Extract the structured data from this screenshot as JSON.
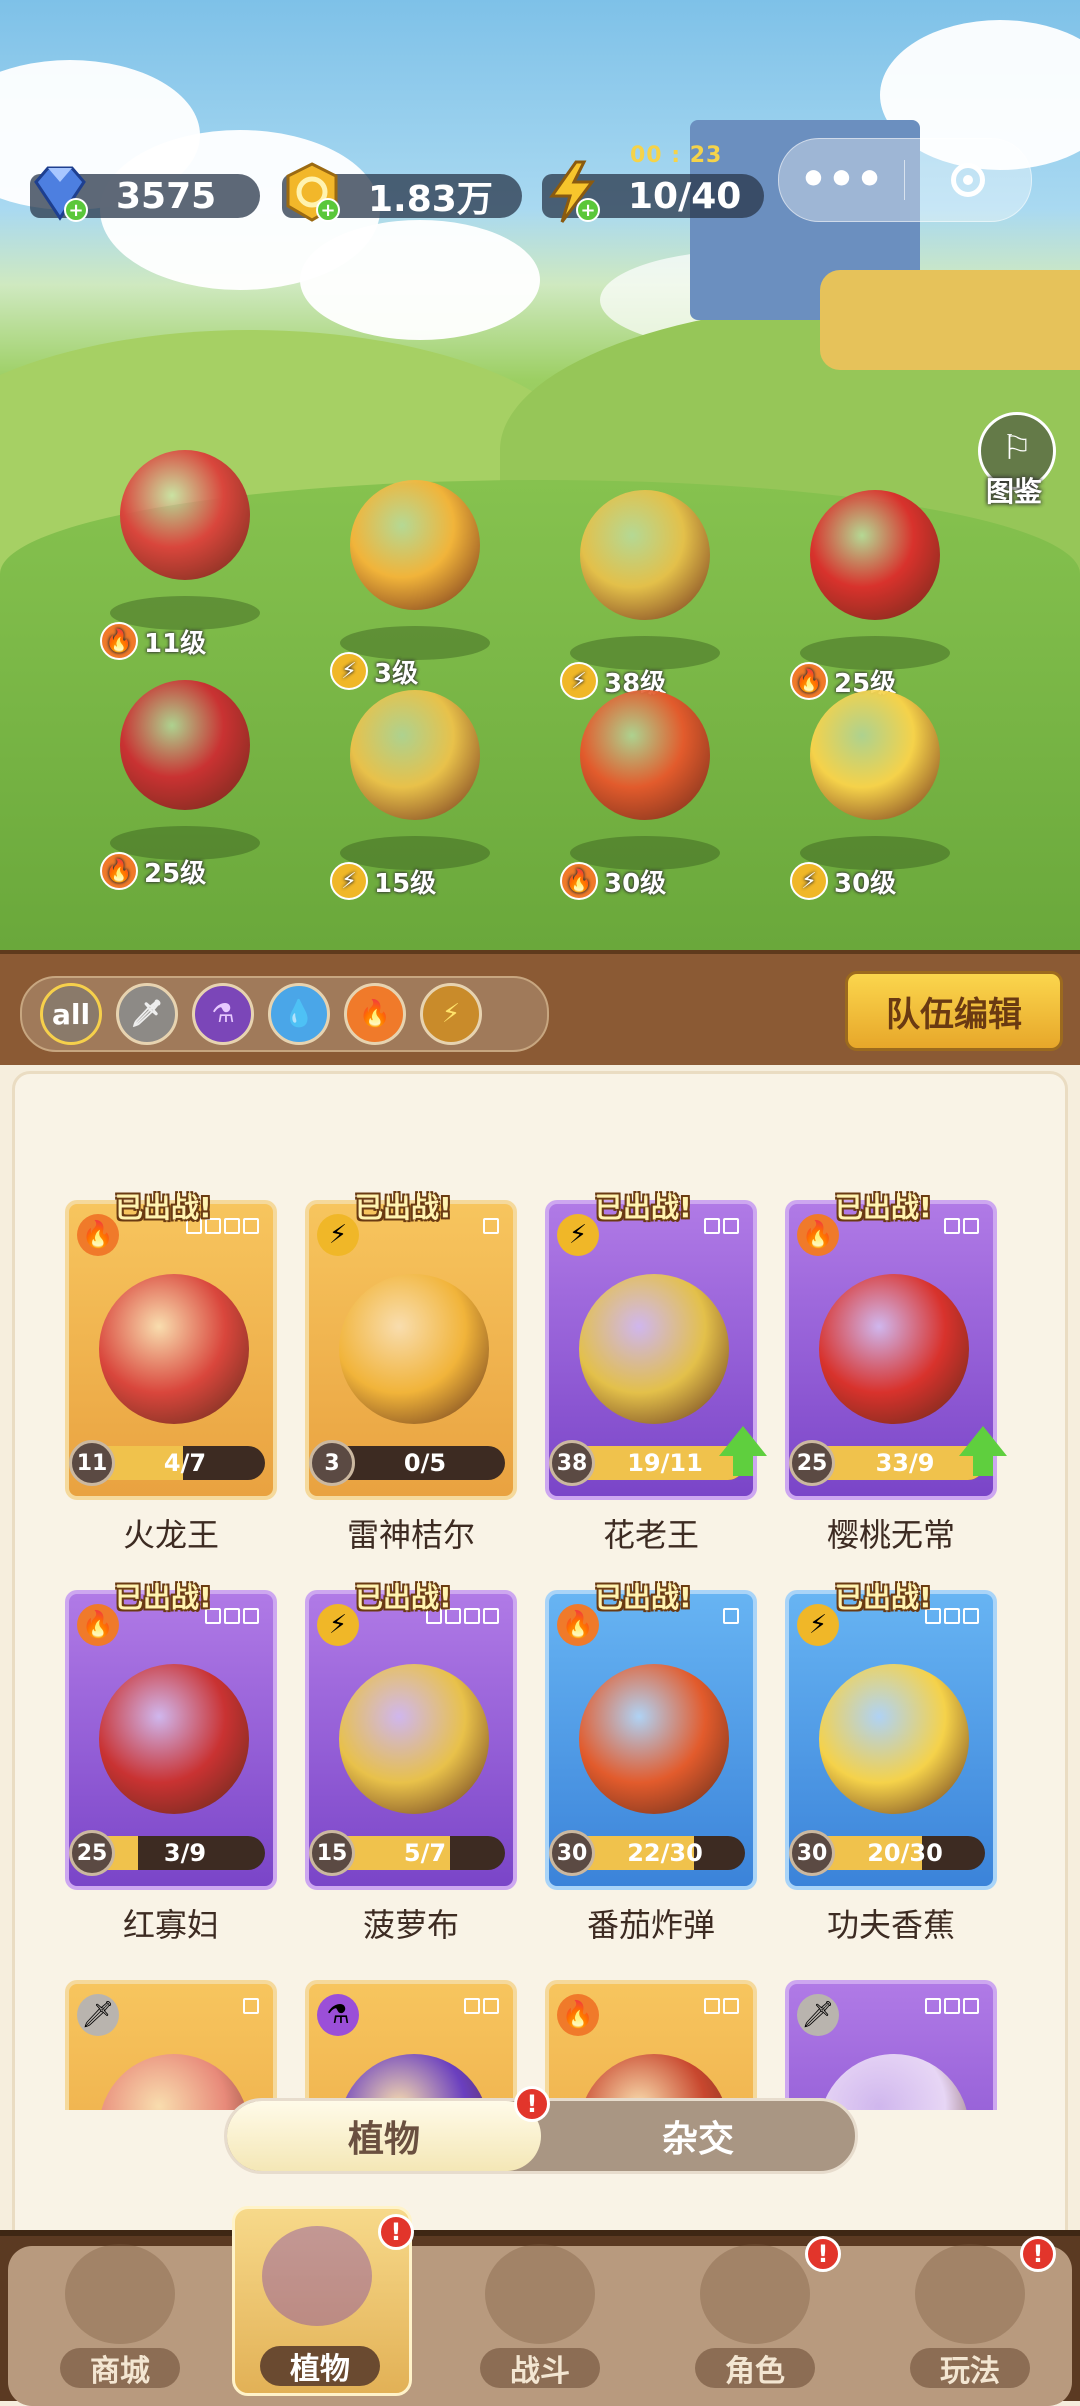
{
  "resources": {
    "gems": "3575",
    "coins": "1.83万",
    "energy": "10/40",
    "energy_timer": "00 : 23"
  },
  "capsule": {
    "menu_icon": "more-dots-icon",
    "close_icon": "target-icon"
  },
  "codex": {
    "label": "图鉴"
  },
  "stage": [
    {
      "level": "11级",
      "element": "fire"
    },
    {
      "level": "3级",
      "element": "bolt"
    },
    {
      "level": "38级",
      "element": "bolt"
    },
    {
      "level": "25级",
      "element": "fire"
    },
    {
      "level": "25级",
      "element": "fire"
    },
    {
      "level": "15级",
      "element": "bolt"
    },
    {
      "level": "30级",
      "element": "fire"
    },
    {
      "level": "30级",
      "element": "bolt"
    }
  ],
  "filters": {
    "all_label": "all",
    "items": [
      "sword-icon",
      "potion-icon",
      "water-icon",
      "fire-icon",
      "bolt-icon"
    ]
  },
  "team_edit_label": "队伍编辑",
  "cards": [
    {
      "name": "火龙王",
      "badge": "已出战!",
      "level": "11",
      "progress": "4/7",
      "fraction": 0.57,
      "rarity": "gold",
      "element": "fire",
      "shape": 4,
      "upgrade": false
    },
    {
      "name": "雷神桔尔",
      "badge": "已出战!",
      "level": "3",
      "progress": "0/5",
      "fraction": 0.0,
      "rarity": "gold",
      "element": "bolt",
      "shape": 1,
      "upgrade": false
    },
    {
      "name": "花老王",
      "badge": "已出战!",
      "level": "38",
      "progress": "19/11",
      "fraction": 1.0,
      "rarity": "purple",
      "element": "bolt",
      "shape": 2,
      "upgrade": true
    },
    {
      "name": "樱桃无常",
      "badge": "已出战!",
      "level": "25",
      "progress": "33/9",
      "fraction": 1.0,
      "rarity": "purple",
      "element": "fire",
      "shape": 2,
      "upgrade": true
    },
    {
      "name": "红寡妇",
      "badge": "已出战!",
      "level": "25",
      "progress": "3/9",
      "fraction": 0.33,
      "rarity": "purple",
      "element": "fire",
      "shape": 3,
      "upgrade": false
    },
    {
      "name": "菠萝布",
      "badge": "已出战!",
      "level": "15",
      "progress": "5/7",
      "fraction": 0.71,
      "rarity": "purple",
      "element": "bolt",
      "shape": 4,
      "upgrade": false
    },
    {
      "name": "番茄炸弹",
      "badge": "已出战!",
      "level": "30",
      "progress": "22/30",
      "fraction": 0.73,
      "rarity": "blue",
      "element": "fire",
      "shape": 1,
      "upgrade": false
    },
    {
      "name": "功夫香蕉",
      "badge": "已出战!",
      "level": "30",
      "progress": "20/30",
      "fraction": 0.67,
      "rarity": "blue",
      "element": "bolt",
      "shape": 3,
      "upgrade": false
    },
    {
      "name": "",
      "badge": "",
      "level": "",
      "progress": "",
      "fraction": 0,
      "rarity": "gold",
      "element": "sword",
      "shape": 1,
      "upgrade": false
    },
    {
      "name": "",
      "badge": "",
      "level": "",
      "progress": "",
      "fraction": 0,
      "rarity": "gold",
      "element": "potion",
      "shape": 2,
      "upgrade": false
    },
    {
      "name": "",
      "badge": "",
      "level": "",
      "progress": "",
      "fraction": 0,
      "rarity": "gold",
      "element": "fire",
      "shape": 2,
      "upgrade": false
    },
    {
      "name": "",
      "badge": "",
      "level": "",
      "progress": "",
      "fraction": 0,
      "rarity": "purple",
      "element": "sword",
      "shape": 3,
      "upgrade": false
    }
  ],
  "toggle": {
    "plants": "植物",
    "hybrid": "杂交",
    "alert": "!"
  },
  "tabs": [
    {
      "label": "商城",
      "alert": false
    },
    {
      "label": "植物",
      "alert": true
    },
    {
      "label": "战斗",
      "alert": false
    },
    {
      "label": "角色",
      "alert": true
    },
    {
      "label": "玩法",
      "alert": true
    }
  ],
  "colors": {
    "fire": "#f07a2a",
    "bolt": "#f0b728",
    "sword": "#b9b4ae",
    "potion": "#9b4fd8",
    "water": "#4aa6e8"
  }
}
